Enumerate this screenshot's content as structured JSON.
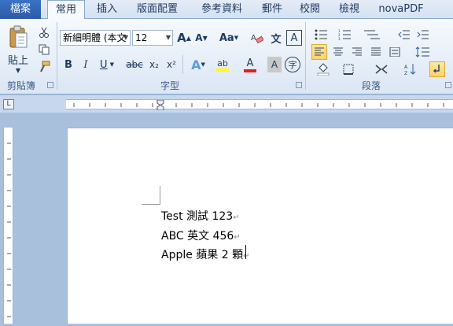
{
  "tabs": {
    "file": "檔案",
    "items": [
      "常用",
      "插入",
      "版面配置",
      "參考資料",
      "郵件",
      "校閱",
      "檢視",
      "novaPDF"
    ]
  },
  "clipboard": {
    "paste_label": "貼上",
    "group_label": "剪貼簿"
  },
  "font": {
    "name_value": "新細明體 (本文",
    "size_value": "12",
    "group_label": "字型",
    "grow_label": "A",
    "shrink_label": "A",
    "case_label": "Aa",
    "bold_label": "B",
    "italic_label": "I",
    "underline_label": "U",
    "strike_label": "abc",
    "subscript_label": "x₂",
    "superscript_label": "x²",
    "highlight_label": "ab",
    "fontcolor_label": "A",
    "shade_label": "A",
    "enclose_label": "字",
    "phonetic_label": "文",
    "border_label": "A"
  },
  "paragraph": {
    "group_label": "段落"
  },
  "document": {
    "lines": [
      "Test 測試 123",
      "ABC 英文 456",
      "Apple 蘋果 2 顆"
    ],
    "mark": "↵"
  },
  "colors": {
    "accent": "#2a5aa8",
    "highlight": "#ffff00",
    "font_color": "#e02020"
  }
}
